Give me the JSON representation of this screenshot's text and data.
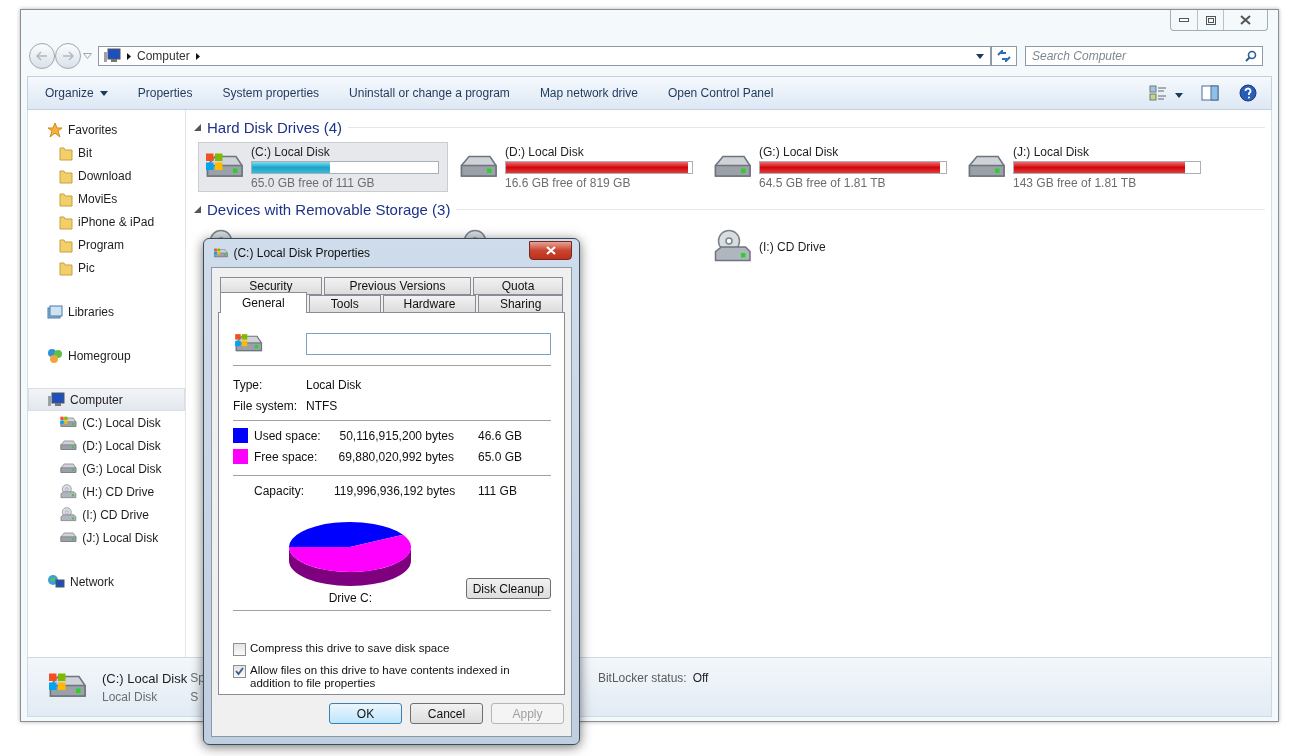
{
  "address_bar": {
    "crumb": "Computer"
  },
  "search": {
    "placeholder": "Search Computer"
  },
  "toolbar": {
    "items": [
      {
        "label": "Organize",
        "dropdown": true
      },
      {
        "label": "Properties",
        "dropdown": false
      },
      {
        "label": "System properties",
        "dropdown": false
      },
      {
        "label": "Uninstall or change a program",
        "dropdown": false
      },
      {
        "label": "Map network drive",
        "dropdown": false
      },
      {
        "label": "Open Control Panel",
        "dropdown": false
      }
    ]
  },
  "sidebar": {
    "groups": [
      {
        "label": "Favorites",
        "kind": "star",
        "selected": false,
        "children": [
          {
            "label": "Bit",
            "kind": "folder",
            "selected": false
          },
          {
            "label": "Download",
            "kind": "folder",
            "selected": false
          },
          {
            "label": "MoviEs",
            "kind": "folder",
            "selected": false
          },
          {
            "label": "iPhone & iPad",
            "kind": "folder",
            "selected": false
          },
          {
            "label": "Program",
            "kind": "folder",
            "selected": false
          },
          {
            "label": "Pic",
            "kind": "folder",
            "selected": false
          }
        ]
      },
      {
        "label": "Libraries",
        "kind": "library",
        "selected": false
      },
      {
        "label": "Homegroup",
        "kind": "homegroup",
        "selected": false
      },
      {
        "label": "Computer",
        "kind": "computer",
        "selected": true,
        "children": [
          {
            "label": "(C:) Local Disk",
            "kind": "system",
            "selected": false
          },
          {
            "label": "(D:) Local Disk",
            "kind": "disk",
            "selected": false
          },
          {
            "label": "(G:) Local Disk",
            "kind": "disk",
            "selected": false
          },
          {
            "label": "(H:) CD Drive",
            "kind": "cd",
            "selected": false
          },
          {
            "label": "(I:) CD Drive",
            "kind": "cd",
            "selected": false
          },
          {
            "label": "(J:) Local Disk",
            "kind": "disk",
            "selected": false
          }
        ]
      },
      {
        "label": "Network",
        "kind": "network",
        "selected": false
      }
    ]
  },
  "sections": [
    {
      "title": "Hard Disk Drives (4)",
      "items": [
        {
          "kind": "system",
          "label": "(C:) Local Disk",
          "free": "65.0 GB free of 111 GB",
          "level": 0.42,
          "warning": false,
          "selected": true
        },
        {
          "kind": "disk",
          "label": "(D:) Local Disk",
          "free": "16.6 GB free of 819 GB",
          "level": 0.98,
          "warning": true,
          "selected": false
        },
        {
          "kind": "disk",
          "label": "(G:) Local Disk",
          "free": "64.5 GB free of 1.81 TB",
          "level": 0.97,
          "warning": true,
          "selected": false
        },
        {
          "kind": "disk",
          "label": "(J:) Local Disk",
          "free": "143 GB free of 1.81 TB",
          "level": 0.92,
          "warning": true,
          "selected": false
        }
      ]
    },
    {
      "title": "Devices with Removable Storage (3)",
      "items": [
        {
          "kind": "covered"
        },
        {
          "kind": "covered"
        },
        {
          "kind": "cd",
          "label": "(I:) CD Drive",
          "selected": false
        }
      ]
    }
  ],
  "details": {
    "name": "(C:) Local Disk",
    "name_cut": "Sp",
    "type": "Local Disk",
    "type_cut": "S",
    "bitlocker_label": "BitLocker status:",
    "bitlocker_value": "Off"
  },
  "dialog": {
    "title": "(C:) Local Disk Properties",
    "tab_rows": [
      [
        {
          "label": "Security",
          "selected": false
        },
        {
          "label": "Previous Versions",
          "selected": false
        },
        {
          "label": "Quota",
          "selected": false
        }
      ],
      [
        {
          "label": "General",
          "selected": true
        },
        {
          "label": "Tools",
          "selected": false
        },
        {
          "label": "Hardware",
          "selected": false
        },
        {
          "label": "Sharing",
          "selected": false
        }
      ]
    ],
    "info": [
      {
        "label": "Type:",
        "value": "Local Disk"
      },
      {
        "label": "File system:",
        "value": "NTFS"
      }
    ],
    "space": [
      {
        "label": "Used space:",
        "bytes": "50,116,915,200 bytes",
        "size": "46.6 GB",
        "color": "#0000ff"
      },
      {
        "label": "Free space:",
        "bytes": "69,880,020,992 bytes",
        "size": "65.0 GB",
        "color": "#ff00ff"
      }
    ],
    "capacity": {
      "label": "Capacity:",
      "bytes": "119,996,936,192 bytes",
      "size": "111 GB"
    },
    "drive_label": "Drive C:",
    "cleanup_button": "Disk Cleanup",
    "options": [
      {
        "label": "Compress this drive to save disk space",
        "checked": false
      },
      {
        "label": "Allow files on this drive to have contents indexed in addition to file properties",
        "checked": true
      }
    ],
    "buttons": [
      {
        "label": "OK",
        "default": true,
        "disabled": false
      },
      {
        "label": "Cancel",
        "default": false,
        "disabled": false
      },
      {
        "label": "Apply",
        "default": false,
        "disabled": true
      }
    ]
  }
}
